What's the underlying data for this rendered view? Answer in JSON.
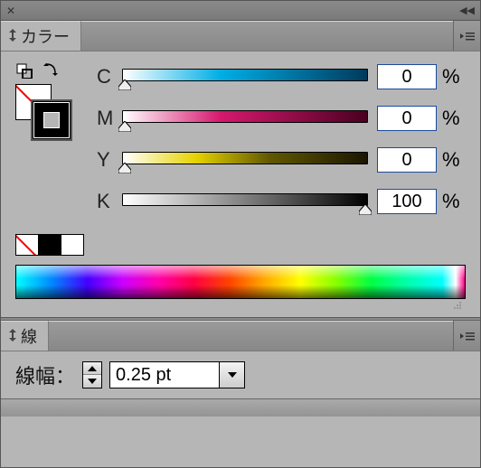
{
  "panels": {
    "color": {
      "title": "カラー",
      "channels": {
        "c": {
          "label": "C",
          "value": "0",
          "unit": "%"
        },
        "m": {
          "label": "M",
          "value": "0",
          "unit": "%"
        },
        "y": {
          "label": "Y",
          "value": "0",
          "unit": "%"
        },
        "k": {
          "label": "K",
          "value": "100",
          "unit": "%"
        }
      }
    },
    "stroke": {
      "title": "線",
      "weight_label": "線幅：",
      "weight_value": "0.25 pt"
    }
  }
}
